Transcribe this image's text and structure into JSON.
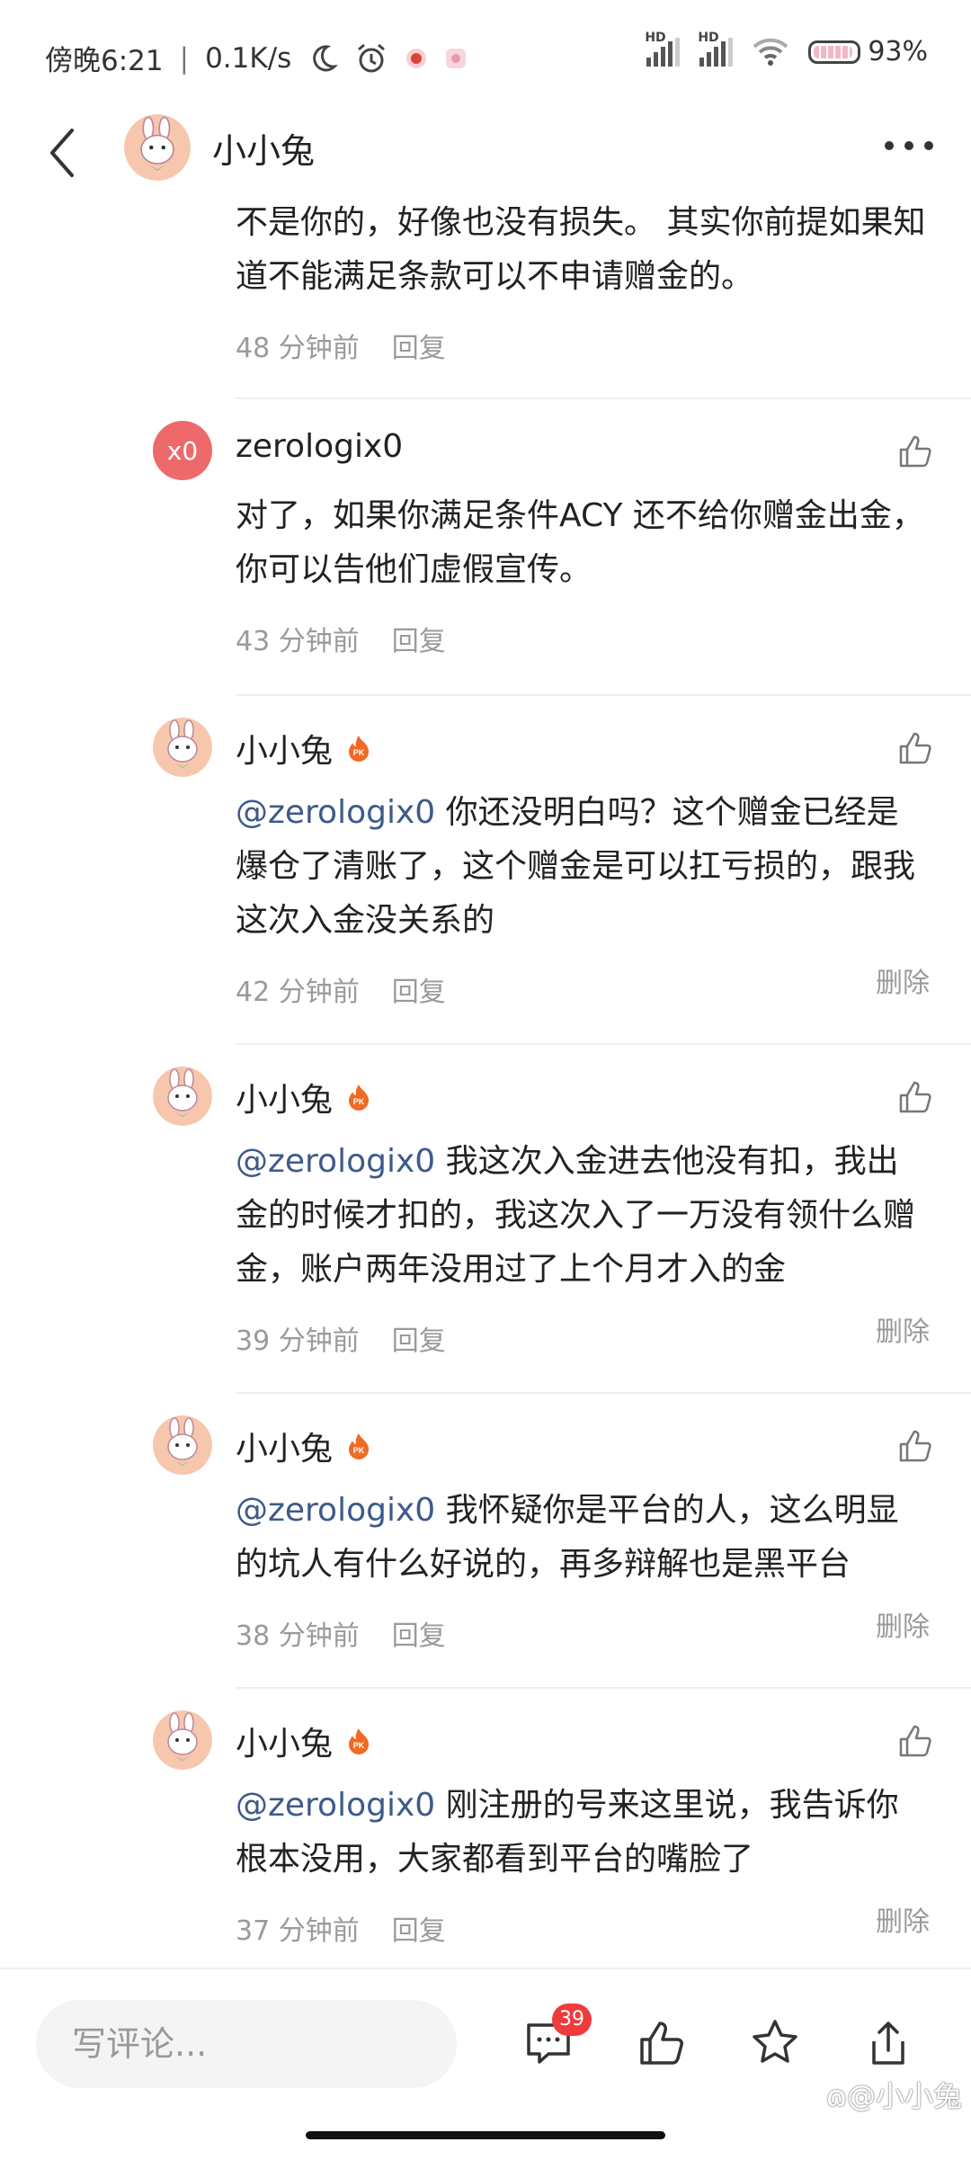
{
  "status_bar": {
    "time": "傍晚6:21",
    "speed": "0.1K/s",
    "sim1_label": "HD",
    "sim2_label": "HD",
    "battery": "93%",
    "battery_level": 0.93
  },
  "header": {
    "title": "小小兔"
  },
  "comments": [
    {
      "text": "不是你的，好像也没有损失。 其实你前提如果知道不能满足条款可以不申请赠金的。",
      "time": "48 分钟前",
      "reply": "回复"
    },
    {
      "author": "zerologix0",
      "avatar_text": "x0",
      "text": "对了，如果你满足条件ACY 还不给你赠金出金，你可以告他们虚假宣传。",
      "time": "43 分钟前",
      "reply": "回复"
    },
    {
      "author": "小小兔",
      "mention": "@zerologix0",
      "text": " 你还没明白吗？这个赠金已经是爆仓了清账了，这个赠金是可以扛亏损的，跟我这次入金没关系的",
      "time": "42 分钟前",
      "reply": "回复",
      "delete": "删除"
    },
    {
      "author": "小小兔",
      "mention": "@zerologix0",
      "text": " 我这次入金进去他没有扣，我出金的时候才扣的，我这次入了一万没有领什么赠金，账户两年没用过了上个月才入的金",
      "time": "39 分钟前",
      "reply": "回复",
      "delete": "删除"
    },
    {
      "author": "小小兔",
      "mention": "@zerologix0",
      "text": " 我怀疑你是平台的人，这么明显的坑人有什么好说的，再多辩解也是黑平台",
      "time": "38 分钟前",
      "reply": "回复",
      "delete": "删除"
    },
    {
      "author": "小小兔",
      "mention": "@zerologix0",
      "text": " 刚注册的号来这里说，我告诉你根本没用，大家都看到平台的嘴脸了",
      "time": "37 分钟前",
      "reply": "回复",
      "delete": "删除"
    }
  ],
  "bottom_bar": {
    "input_placeholder": "写评论...",
    "comment_count": "39"
  },
  "watermark": "ɷ@小小兔",
  "colors": {
    "mention": "#3e5a8a",
    "meta": "#9a9a9a",
    "badge_red": "#ee3b3b",
    "avatar_x0": "#ee6a6a"
  }
}
